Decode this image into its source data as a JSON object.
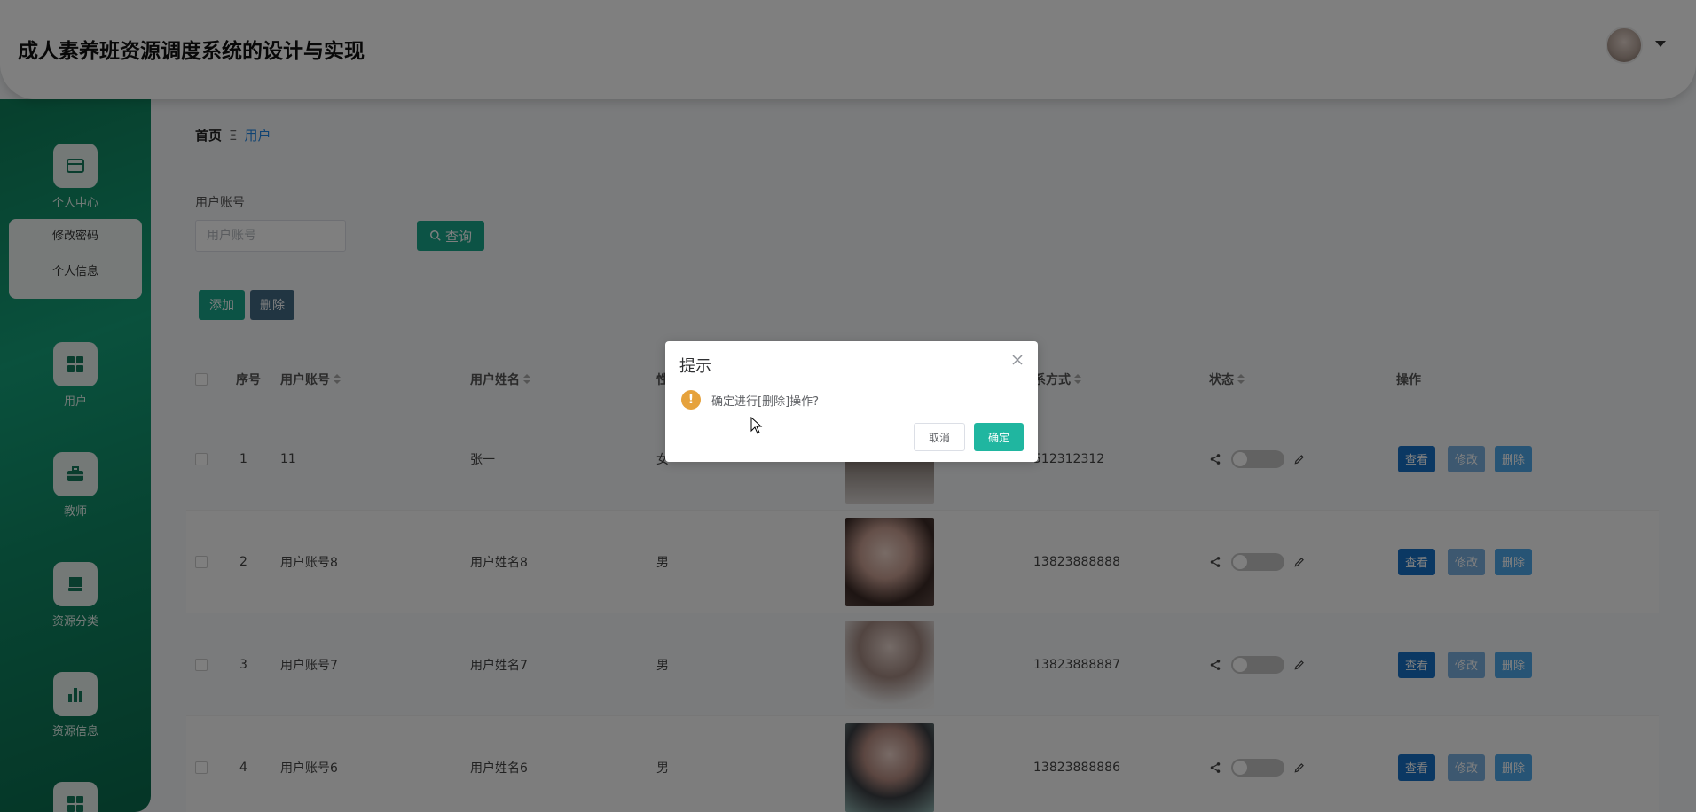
{
  "header": {
    "title": "成人素养班资源调度系统的设计与实现"
  },
  "sidebar": {
    "personal_center": "个人中心",
    "submenu": [
      "修改密码",
      "个人信息"
    ],
    "items": [
      {
        "label": "用户",
        "icon": "grid-icon"
      },
      {
        "label": "教师",
        "icon": "briefcase-icon"
      },
      {
        "label": "资源分类",
        "icon": "folder-icon"
      },
      {
        "label": "资源信息",
        "icon": "bar-chart-icon"
      }
    ]
  },
  "breadcrumb": {
    "home": "首页",
    "separator": "Ξ",
    "current": "用户"
  },
  "search": {
    "label": "用户账号",
    "placeholder": "用户账号",
    "query_label": "查询"
  },
  "toolbar": {
    "add_label": "添加",
    "delete_label": "删除"
  },
  "table": {
    "headers": {
      "index": "序号",
      "account": "用户账号",
      "name": "用户姓名",
      "gender": "性",
      "phone": "系方式",
      "status": "状态",
      "actions": "操作"
    },
    "rows": [
      {
        "index": "1",
        "account": "11",
        "name": "张一",
        "gender": "女",
        "phone": "512312312"
      },
      {
        "index": "2",
        "account": "用户账号8",
        "name": "用户姓名8",
        "gender": "男",
        "phone": "13823888888"
      },
      {
        "index": "3",
        "account": "用户账号7",
        "name": "用户姓名7",
        "gender": "男",
        "phone": "13823888887"
      },
      {
        "index": "4",
        "account": "用户账号6",
        "name": "用户姓名6",
        "gender": "男",
        "phone": "13823888886"
      }
    ],
    "action_labels": {
      "view": "查看",
      "edit": "修改",
      "delete": "删除"
    }
  },
  "dialog": {
    "title": "提示",
    "message": "确定进行[删除]操作?",
    "cancel_label": "取消",
    "confirm_label": "确定"
  },
  "colors": {
    "sidebar": "#14a27a",
    "primary": "#18a68b",
    "view": "#1771c7",
    "warning": "#e6a23c"
  }
}
